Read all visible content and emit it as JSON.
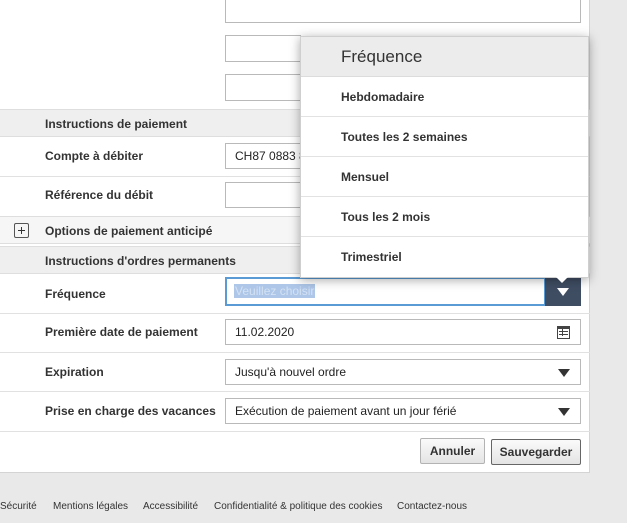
{
  "sections": {
    "payment_instructions": "Instructions de paiement",
    "early_payment_options": "Options de paiement anticipé",
    "standing_order_instructions": "Instructions d'ordres permanents"
  },
  "fields": {
    "debit_account": {
      "label": "Compte à débiter",
      "value": "CH87 0883 8"
    },
    "debit_reference": {
      "label": "Référence du débit",
      "value": ""
    },
    "frequency": {
      "label": "Fréquence",
      "placeholder": "Veuillez choisir"
    },
    "first_payment_date": {
      "label": "Première date de paiement",
      "value": "11.02.2020"
    },
    "expiration": {
      "label": "Expiration",
      "value": "Jusqu'à nouvel ordre"
    },
    "holiday_handling": {
      "label": "Prise en charge des vacances",
      "value": "Exécution de paiement avant un jour férié"
    }
  },
  "buttons": {
    "cancel": "Annuler",
    "save": "Sauvegarder"
  },
  "dropdown": {
    "title": "Fréquence",
    "options": [
      "Hebdomadaire",
      "Toutes les 2 semaines",
      "Mensuel",
      "Tous les 2 mois",
      "Trimestriel"
    ]
  },
  "footer": {
    "links": [
      "Sécurité",
      "Mentions légales",
      "Accessibilité",
      "Confidentialité & politique des cookies",
      "Contactez-nous"
    ]
  },
  "colors": {
    "accent": "#3f4d63",
    "focus_border": "#5b9bd5",
    "placeholder_highlight": "#aec6e8"
  },
  "icons": {
    "expand": "plus-icon",
    "select": "caret-down-icon",
    "date": "calendar-icon"
  }
}
